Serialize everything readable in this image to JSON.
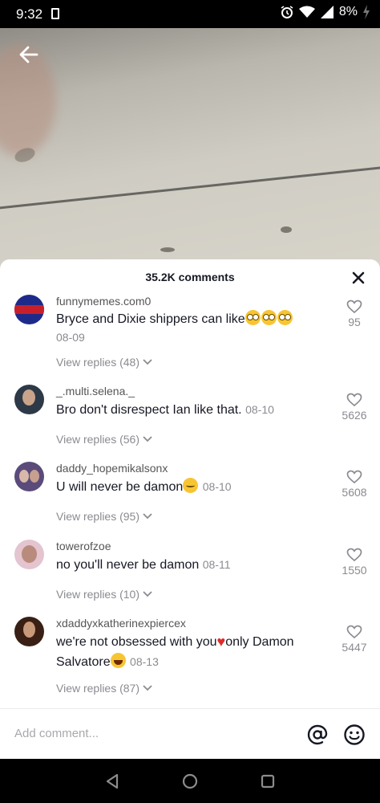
{
  "status_bar": {
    "time": "9:32",
    "battery": "8%"
  },
  "comments_sheet": {
    "count_label": "35.2K comments",
    "comments": [
      {
        "username": "funnymemes.com0",
        "text": "Bryce and Dixie shippers can like",
        "date": "08-09",
        "likes": "95",
        "replies": "View replies (48)",
        "avatar_color": "#1e2a8a"
      },
      {
        "username": "_.multi.selena._",
        "text": "Bro don't disrespect Ian like that.",
        "date": "08-10",
        "likes": "5626",
        "replies": "View replies (56)",
        "avatar_color": "#2d3947"
      },
      {
        "username": "daddy_hopemikalsonx",
        "text": "U will never be damon",
        "date": "08-10",
        "likes": "5608",
        "replies": "View replies (95)",
        "avatar_color": "#5a4b7a"
      },
      {
        "username": "towerofzoe",
        "text": "no you'll never be damon",
        "date": "08-11",
        "likes": "1550",
        "replies": "View replies (10)",
        "avatar_color": "#d9b3c4"
      },
      {
        "username": "xdaddyxkatherinexpiercex",
        "text": "we're not obsessed with you",
        "text2": "only Damon",
        "text3": "Salvatore",
        "date": "08-13",
        "likes": "5447",
        "replies": "View replies (87)",
        "avatar_color": "#3a1f14"
      }
    ],
    "input_placeholder": "Add comment..."
  },
  "icons": {
    "back": "arrow-left-icon",
    "close": "close-icon",
    "like": "heart-outline-icon",
    "mention": "at-icon",
    "emoji": "smiley-icon"
  }
}
